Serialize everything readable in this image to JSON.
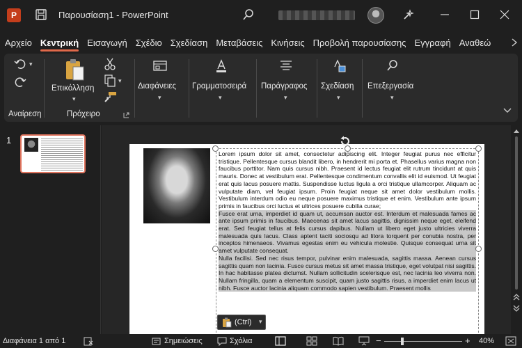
{
  "titlebar": {
    "app_badge": "P",
    "document_title": "Παρουσίαση1  -  PowerPoint"
  },
  "tabs": [
    {
      "label": "Αρχείο",
      "active": false
    },
    {
      "label": "Κεντρική",
      "active": true
    },
    {
      "label": "Εισαγωγή",
      "active": false
    },
    {
      "label": "Σχέδιο",
      "active": false
    },
    {
      "label": "Σχεδίαση",
      "active": false
    },
    {
      "label": "Μεταβάσεις",
      "active": false
    },
    {
      "label": "Κινήσεις",
      "active": false
    },
    {
      "label": "Προβολή παρουσίασης",
      "active": false
    },
    {
      "label": "Εγγραφή",
      "active": false
    },
    {
      "label": "Αναθεώ",
      "active": false
    }
  ],
  "ribbon": {
    "undo_group_label": "Αναίρεση",
    "clipboard_group_label": "Πρόχειρο",
    "paste_label": "Επικόλληση",
    "slides_label": "Διαφάνειες",
    "font_label": "Γραμματοσειρά",
    "paragraph_label": "Παράγραφος",
    "drawing_label": "Σχεδίαση",
    "editing_label": "Επεξεργασία"
  },
  "thumbnails": {
    "slide_number": "1"
  },
  "slide": {
    "paragraph1": "Lorem ipsum dolor sit amet, consectetur adipiscing elit. Integer feugiat purus nec efficitur tristique. Pellentesque cursus blandit libero, in hendrerit mi porta et. Phasellus varius magna non faucibus porttitor. Nam quis cursus nibh. Praesent id lectus feugiat elit rutrum tincidunt at quis mauris. Donec at vestibulum erat. Pellentesque condimentum convallis elit id euismod. Ut feugiat erat quis lacus posuere mattis. Suspendisse luctus ligula a orci tristique ullamcorper. Aliquam ac vulputate diam, vel feugiat ipsum. Proin feugiat neque sit amet dolor vestibulum mollis. Vestibulum interdum odio eu neque posuere maximus tristique et enim. Vestibulum ante ipsum primis in faucibus orci luctus et ultrices posuere cubilia curae;",
    "paragraph2": "Fusce erat urna, imperdiet id quam ut, accumsan auctor est. Interdum et malesuada fames ac ante ipsum primis in faucibus. Maecenas sit amet lacus sagittis, dignissim neque eget, eleifend erat. Sed feugiat tellus at felis cursus dapibus. Nullam ut libero eget justo ultricies viverra malesuada quis lacus. Class aptent taciti sociosqu ad litora torquent per conubia nostra, per inceptos himenaeos. Vivamus egestas enim eu vehicula molestie. Quisque consequat urna sit amet vulputate consequat.",
    "paragraph3": "Nulla facilisi. Sed nec risus tempor, pulvinar enim malesuada, sagittis massa. Aenean cursus sagittis quam non lacinia. Fusce cursus metus sit amet massa tristique, eget volutpat nisi sagittis. In hac habitasse platea dictumst. Nullam sollicitudin scelerisque est, nec lacinia leo viverra non. Nullam fringilla, quam a elementum suscipit, quam justo sagittis risus, a imperdiet enim lacus ut nibh. Fusce auctor lacinia aliquam commodo sapien vestibulum. Praesent mollis"
  },
  "paste_options": {
    "label": "(Ctrl)"
  },
  "statusbar": {
    "slide_position": "Διαφάνεια 1 από 1",
    "notes_label": "Σημειώσεις",
    "comments_label": "Σχόλια",
    "zoom_level": "40%"
  },
  "colors": {
    "accent": "#e0694a",
    "app_badge": "#c43e1c"
  }
}
